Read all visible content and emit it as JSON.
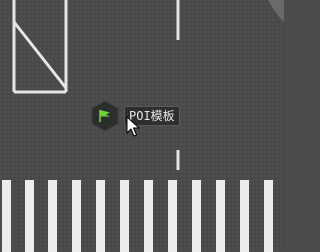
{
  "map": {
    "colors": {
      "asphalt": "#4b4b4b",
      "road_marking": "#e6e6e6",
      "curb_top_right": "#6a6a6a",
      "poi_marker_fill": "#2b2f2b",
      "poi_flag": "#6fd13a"
    }
  },
  "poi": {
    "icon": "flag-icon",
    "label": "POI模板"
  },
  "cursor": {
    "icon": "mouse-pointer-icon"
  }
}
